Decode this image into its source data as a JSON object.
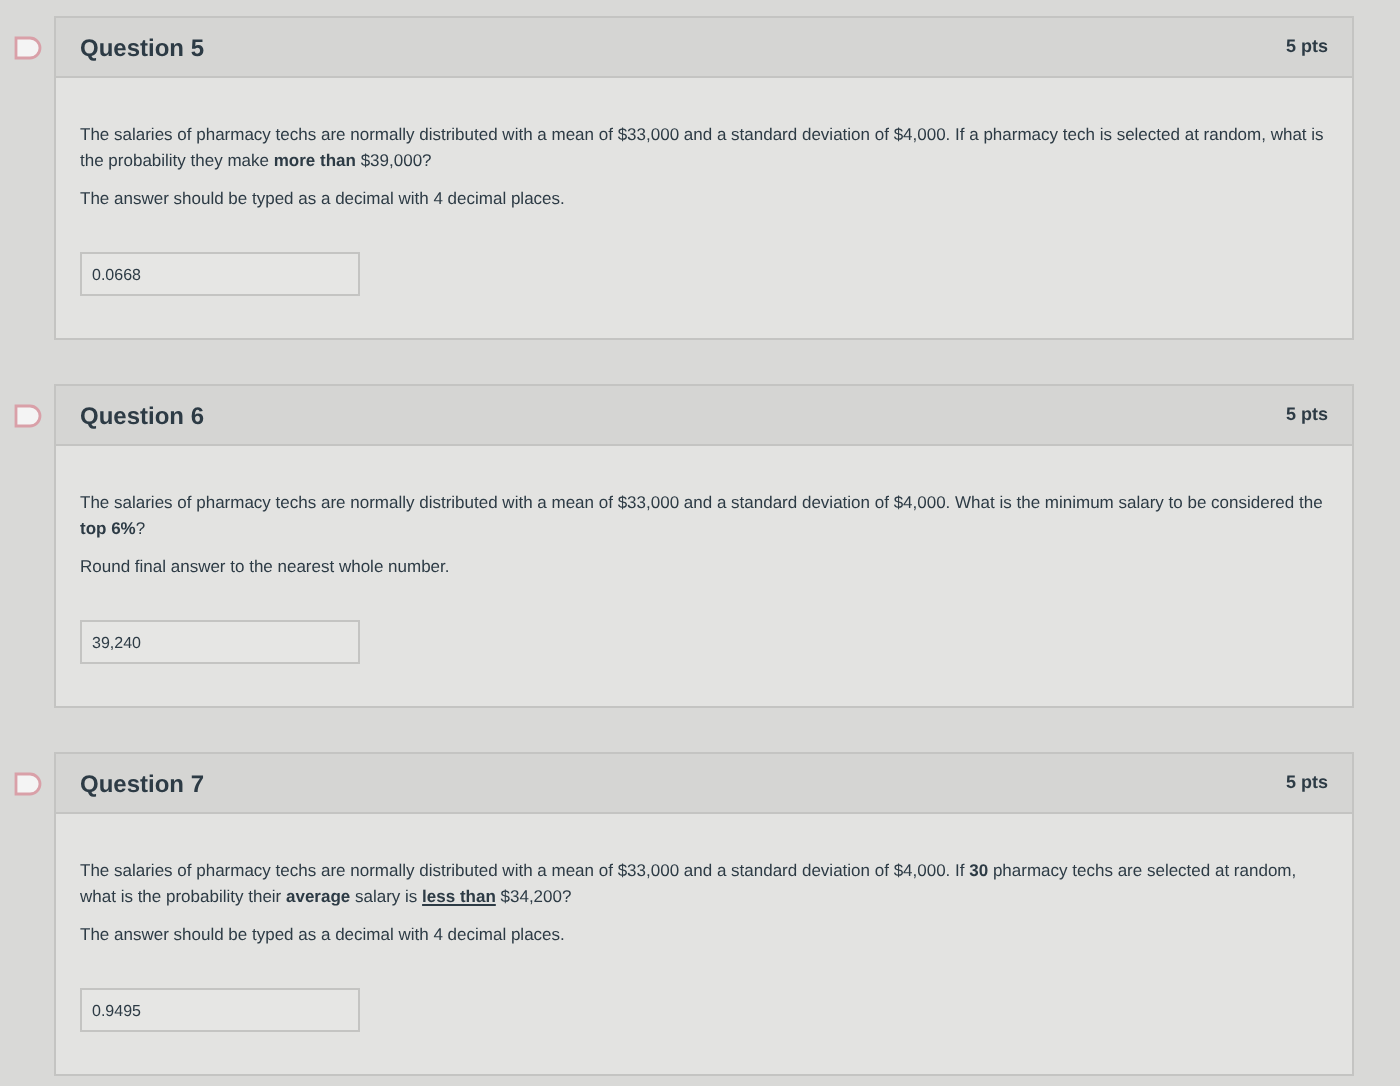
{
  "questions": [
    {
      "title": "Question 5",
      "points": "5 pts",
      "paragraphs": [
        "The salaries of pharmacy techs are normally distributed  with a mean of $33,000 and a standard deviation of $4,000.  If a pharmacy tech is selected at random, what is the probability they make **more than** $39,000?",
        "The answer should be typed as a decimal with 4 decimal places."
      ],
      "answer": "0.0668"
    },
    {
      "title": "Question 6",
      "points": "5 pts",
      "paragraphs": [
        "The salaries of pharmacy techs are normally distributed with a mean of $33,000 and a standard deviation of $4,000. What is the minimum salary to be considered the **top 6%**?",
        "Round final answer to the nearest whole number."
      ],
      "answer": "39,240"
    },
    {
      "title": "Question 7",
      "points": "5 pts",
      "paragraphs": [
        [
          {
            "kind": "plain",
            "text": "The salaries of pharmacy techs are normally distributed  with a mean of $33,000 and a standard deviation of $4,000.  If "
          },
          {
            "kind": "strong",
            "text": "30"
          },
          {
            "kind": "plain",
            "text": " pharmacy techs are selected at random, what is the probability their "
          },
          {
            "kind": "strong",
            "text": "average"
          },
          {
            "kind": "plain",
            "text": " salary is "
          },
          {
            "kind": "underlined",
            "text": "less than"
          },
          {
            "kind": "plain",
            "text": " $34,200?"
          }
        ],
        "The answer should be typed as a decimal with 4 decimal places."
      ],
      "answer": "0.9495"
    }
  ]
}
